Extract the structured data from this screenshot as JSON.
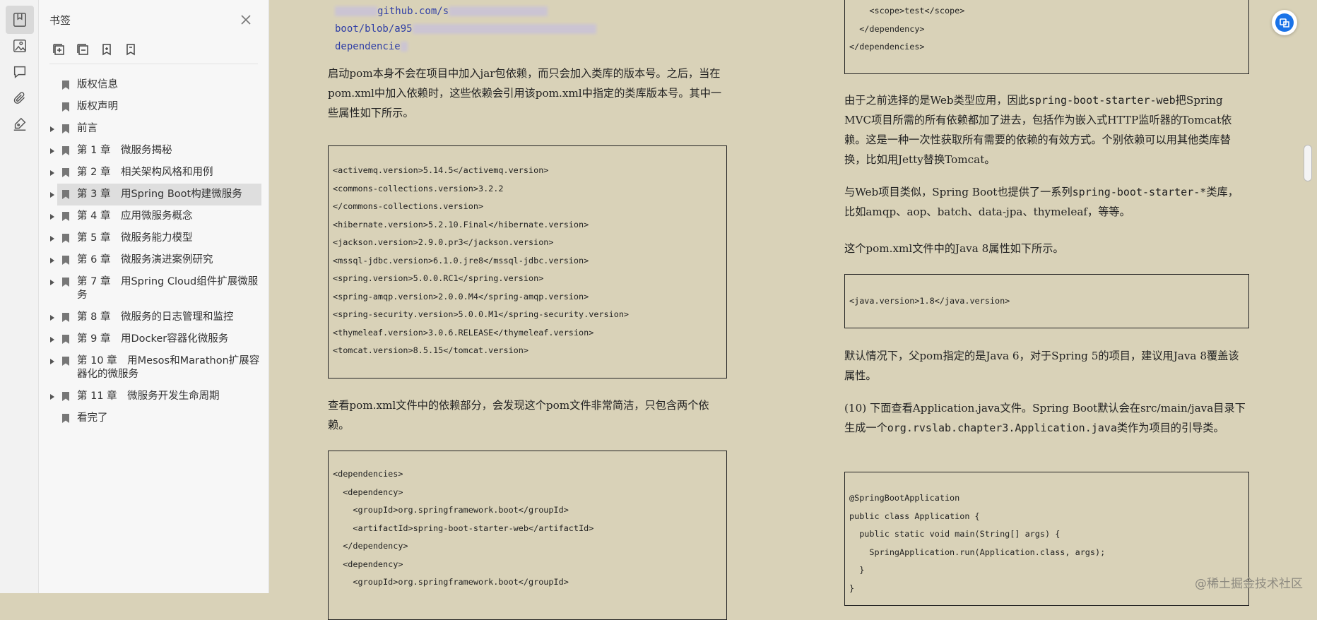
{
  "rail": {
    "items": [
      {
        "icon": "bookmark-icon",
        "active": true
      },
      {
        "icon": "image-icon",
        "active": false
      },
      {
        "icon": "comment-icon",
        "active": false
      },
      {
        "icon": "paperclip-icon",
        "active": false
      },
      {
        "icon": "signature-icon",
        "active": false
      }
    ]
  },
  "panel": {
    "title": "书签",
    "toolbar": [
      "expand-all-icon",
      "collapse-all-icon",
      "add-bookmark-icon",
      "bookmark-outline-icon"
    ],
    "items": [
      {
        "label": "版权信息",
        "expandable": false
      },
      {
        "label": "版权声明",
        "expandable": false
      },
      {
        "label": "前言",
        "expandable": true
      },
      {
        "label": "第 1 章　微服务揭秘",
        "expandable": true
      },
      {
        "label": "第 2 章　相关架构风格和用例",
        "expandable": true
      },
      {
        "label": "第 3 章　用Spring Boot构建微服务",
        "expandable": true,
        "selected": true
      },
      {
        "label": "第 4 章　应用微服务概念",
        "expandable": true
      },
      {
        "label": "第 5 章　微服务能力模型",
        "expandable": true
      },
      {
        "label": "第 6 章　微服务演进案例研究",
        "expandable": true
      },
      {
        "label": "第 7 章　用Spring Cloud组件扩展微服务",
        "expandable": true
      },
      {
        "label": "第 8 章　微服务的日志管理和监控",
        "expandable": true
      },
      {
        "label": "第 9 章　用Docker容器化微服务",
        "expandable": true
      },
      {
        "label": "第 10 章　用Mesos和Marathon扩展容器化的微服务",
        "expandable": true
      },
      {
        "label": "第 11 章　微服务开发生命周期",
        "expandable": true
      },
      {
        "label": "看完了",
        "expandable": false
      }
    ]
  },
  "doc": {
    "left": {
      "url_lines": [
        "github.com/s",
        "boot/blob/a95",
        "dependencie"
      ],
      "para1": "启动pom本身不会在项目中加入jar包依赖，而只会加入类库的版本号。之后，当在pom.xml中加入依赖时，这些依赖会引用该pom.xml中指定的类库版本号。其中一些属性如下所示。",
      "code1": [
        "<activemq.version>5.14.5</activemq.version>",
        "<commons-collections.version>3.2.2",
        "</commons-collections.version>",
        "<hibernate.version>5.2.10.Final</hibernate.version>",
        "<jackson.version>2.9.0.pr3</jackson.version>",
        "<mssql-jdbc.version>6.1.0.jre8</mssql-jdbc.version>",
        "<spring.version>5.0.0.RC1</spring.version>",
        "<spring-amqp.version>2.0.0.M4</spring-amqp.version>",
        "<spring-security.version>5.0.0.M1</spring-security.version>",
        "<thymeleaf.version>3.0.6.RELEASE</thymeleaf.version>",
        "<tomcat.version>8.5.15</tomcat.version>"
      ],
      "para2": "查看pom.xml文件中的依赖部分，会发现这个pom文件非常简洁，只包含两个依赖。",
      "code2": [
        "<dependencies>",
        "  <dependency>",
        "    <groupId>org.springframework.boot</groupId>",
        "    <artifactId>spring-boot-starter-web</artifactId>",
        "  </dependency>",
        "  <dependency>",
        "    <groupId>org.springframework.boot</groupId>"
      ]
    },
    "right": {
      "code0": [
        "    <scope>test</scope>",
        "  </dependency>",
        "</dependencies>"
      ],
      "para1_a": "由于之前选择的是Web类型应用，因此",
      "para1_mono": "spring-boot-starter-web",
      "para1_b": "把Spring MVC项目所需的所有依赖都加了进去，包括作为嵌入式HTTP监听器的Tomcat依赖。这是一种一次性获取所有需要的依赖的有效方式。个别依赖可以用其他类库替换，比如用Jetty替换Tomcat。",
      "para2_a": "与Web项目类似，Spring Boot也提供了一系列",
      "para2_mono": "spring-boot-starter-*",
      "para2_b": "类库，比如amqp、aop、batch、data-jpa、thymeleaf，等等。",
      "para3": "这个pom.xml文件中的Java 8属性如下所示。",
      "code3": [
        "<java.version>1.8</java.version>"
      ],
      "para4": "默认情况下，父pom指定的是Java 6，对于Spring 5的项目，建议用Java 8覆盖该属性。",
      "para5_a": "(10) 下面查看Application.java文件。Spring Boot默认会在src/main/java目录下生成一个",
      "para5_mono": "org.rvslab.chapter3.Application.java",
      "para5_b": "类作为项目的引导类。",
      "code4": [
        "@SpringBootApplication",
        "public class Application {",
        "  public static void main(String[] args) {",
        "    SpringApplication.run(Application.class, args);",
        "  }",
        "}"
      ]
    }
  },
  "watermark": "@稀土掘金技术社区",
  "colors": {
    "page_bg": "#d9d2b8",
    "panel_bg": "#f7f7f7",
    "link": "#2f3ea6",
    "accent": "#1a73e8"
  }
}
